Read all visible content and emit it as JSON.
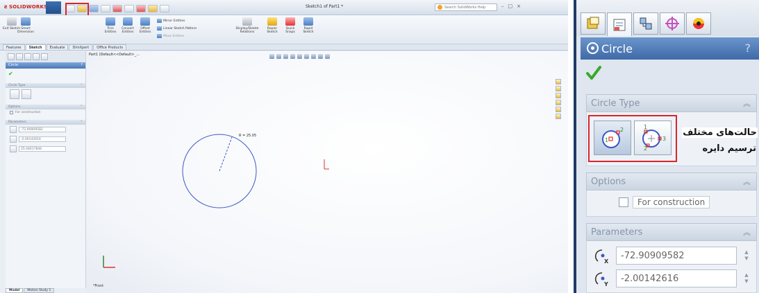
{
  "app": {
    "logo_text": "SOLIDWORKS",
    "window_title": "Sketch1 of Part1 *",
    "search_placeholder": "Search SolidWorks Help"
  },
  "ribbon": {
    "buttons": [
      "Exit Sketch",
      "Smart Dimension",
      "Trim Entities",
      "Convert Entities",
      "Offset Entities",
      "Linear Sketch Pattern",
      "Display/Delete Relations",
      "Repair Sketch",
      "Quick Snaps",
      "Rapid Sketch"
    ],
    "small_items": [
      "Mirror Entities",
      "Move Entities"
    ]
  },
  "command_tabs": [
    "Features",
    "Sketch",
    "Evaluate",
    "DimXpert",
    "Office Products"
  ],
  "active_command_tab": "Sketch",
  "left_pm": {
    "title": "Circle",
    "help": "?",
    "sections": {
      "circle_type": "Circle Type",
      "options": "Options",
      "parameters": "Parameters"
    },
    "for_construction": "For construction",
    "param_x": "-72.90909582",
    "param_y": "-2.00142616",
    "param_r": "25.04617846"
  },
  "bottom_tabs": [
    "Model",
    "Motion Study 1"
  ],
  "graphics": {
    "tree_root": "Part1 (Default<<Default>_...",
    "radius_label": "R = 25.05",
    "view_label": "*Front"
  },
  "zoom_pm": {
    "title": "Circle",
    "help": "?",
    "section_circle_type": "Circle Type",
    "section_options": "Options",
    "section_parameters": "Parameters",
    "for_construction": "For construction",
    "param_x": "-72.90909582",
    "param_y": "-2.00142616",
    "persian_line1": "حالت‌های مختلف",
    "persian_line2": "ترسیم دایره",
    "colors": {
      "title_bar": "#4f7cba",
      "highlight_box": "#d6262a",
      "ok_check": "#3aa82a"
    }
  }
}
